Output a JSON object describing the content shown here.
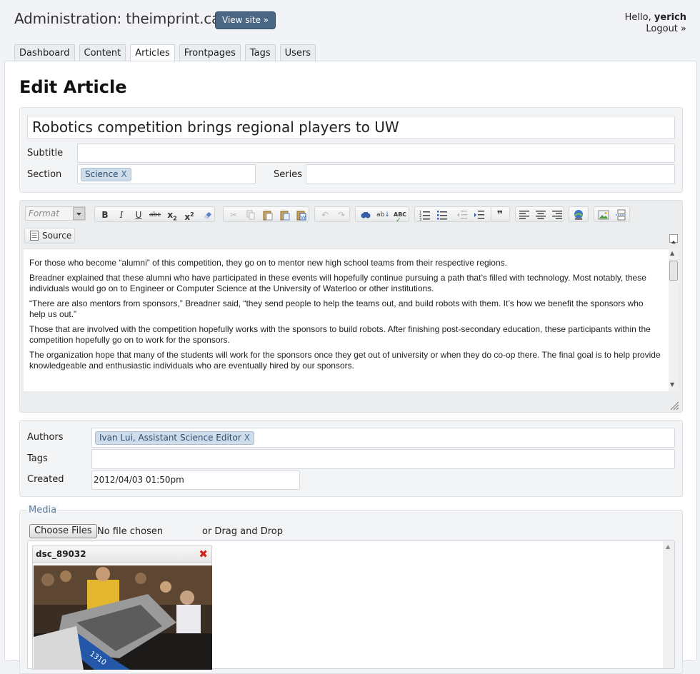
{
  "header": {
    "title": "Administration: theimprint.ca",
    "view_site": "View site »",
    "hello": "Hello,",
    "username": "yerich",
    "logout": "Logout »"
  },
  "tabs": [
    {
      "label": "Dashboard"
    },
    {
      "label": "Content"
    },
    {
      "label": "Articles",
      "active": true
    },
    {
      "label": "Frontpages"
    },
    {
      "label": "Tags"
    },
    {
      "label": "Users"
    }
  ],
  "page_title": "Edit Article",
  "article": {
    "title": "Robotics competition brings regional players to UW",
    "subtitle_label": "Subtitle",
    "subtitle": "",
    "section_label": "Section",
    "section_chip": "Science",
    "series_label": "Series",
    "series": ""
  },
  "editor": {
    "format_placeholder": "Format",
    "source_label": "Source",
    "paragraphs": [
      "For those who become “alumni” of this competition, they go on to mentor new high school teams from their respective regions.",
      "Breadner explained that these alumni who have participated in these events will hopefully continue pursuing a path that’s filled with technology. Most notably, these individuals would go on to Engineer or Computer Science at the University of Waterloo or other institutions.",
      "“There are also mentors from sponsors,” Breadner said, “they send people to help the teams out, and build robots with them. It’s how we benefit the sponsors who help us out.”",
      "Those that are involved with the competition hopefully works with the sponsors to build robots. After finishing post-secondary education, these participants within the competition hopefully go on to work for the sponsors.",
      "The organization hope that many of the students will work for the sponsors once they get out of university or when they do co-op there. The final goal is to help provide knowledgeable and enthusiastic individuals who are eventually hired by our sponsors."
    ]
  },
  "meta": {
    "authors_label": "Authors",
    "author_chip": "Ivan Lui, Assistant Science Editor",
    "tags_label": "Tags",
    "tags": "",
    "created_label": "Created",
    "created": "2012/04/03 01:50pm"
  },
  "media": {
    "legend": "Media",
    "choose_files": "Choose Files",
    "no_file": "No file chosen",
    "drag_drop": "or Drag and Drop",
    "items": [
      {
        "name": "dsc_89032"
      }
    ]
  },
  "chip_remove": "X",
  "colors": {
    "accent": "#4a6785",
    "chip_bg": "#cfdcea",
    "legend": "#5a7fa8",
    "delete": "#d0221a"
  }
}
